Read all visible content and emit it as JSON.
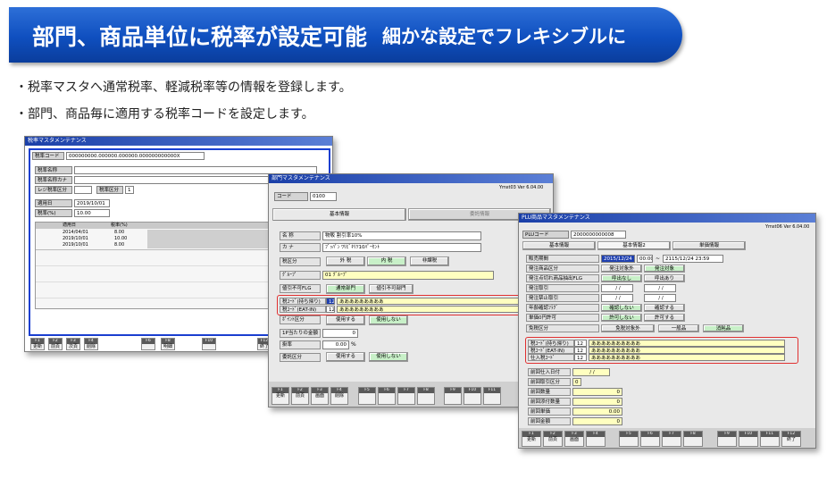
{
  "banner": {
    "title": "部門、商品単位に税率が設定可能",
    "subtitle": "細かな設定でフレキシブルに"
  },
  "bullets": [
    "・税率マスタへ通常税率、軽減税率等の情報を登録します。",
    "・部門、商品毎に適用する税率コードを設定します。"
  ],
  "window1": {
    "title": "税率マスタメンテナンス",
    "code_label": "税率コード",
    "code_value": "000000000.000000.000000.000000000000X",
    "name_label": "税率名称",
    "kana_label": "税率名称カナ",
    "rank_label": "レジ税率区分",
    "area_label": "税率区分",
    "area_value": "1",
    "start_label": "適用日",
    "start_value": "2019/10/01",
    "rate_label": "税率(%)",
    "rate_value": "10.00",
    "grid_headers": [
      "適用日",
      "税率(%)"
    ],
    "grid_rows": [
      [
        "2014/04/01",
        "8.00"
      ],
      [
        "2019/10/01",
        "10.00"
      ],
      [
        "2019/10/01",
        "8.00"
      ]
    ],
    "fkeys": [
      "F1",
      "F2",
      "F3",
      "F4",
      "F6",
      "F8",
      "F10",
      "F12"
    ],
    "fkey_labels": [
      "更新",
      "前頁",
      "次頁",
      "削除",
      "",
      "明細",
      "",
      "終了"
    ]
  },
  "window2": {
    "title": "部門マスタメンテナンス",
    "version": "Ymst03  Ver 6.04.00",
    "code_label": "コード",
    "code_value": "0100",
    "tab_basic": "基本情報",
    "tab_delegate": "委託情報",
    "name_label": "名 称",
    "name_value": "物販 割引率10%",
    "kana_label": "カ ナ",
    "kana_value": "ﾌﾞｯﾊﾟﾝ ﾜﾘﾋﾞｷﾘﾂ10ﾊﾟｰｾﾝﾄ",
    "taxkind_label": "税区分",
    "taxkind_opts": [
      "外 税",
      "内 税",
      "非課税"
    ],
    "group_label": "ｸﾞﾙｰﾌﾟ",
    "group_value": "01 ｸﾞﾙｰﾌﾟ",
    "discount_label": "値引不可FLG",
    "discount_opts": [
      "通常部門",
      "値引不可部門"
    ],
    "taxcode_take_label": "税ｺｰﾄﾞ(持ち帰り)",
    "taxcode_take_value": "12",
    "taxcode_take_name": "あああああああああ",
    "taxcode_eat_label": "税ｺｰﾄﾞ(EAT-IN)",
    "taxcode_eat_value": "12",
    "taxcode_eat_name": "あああああああああ",
    "point_label": "ﾎﾟｲﾝﾄ区分",
    "point_opts": [
      "使用する",
      "使用しない"
    ],
    "pointrate_label": "1P当たりの金額",
    "pointrate_value": "0",
    "rate_label": "掛率",
    "rate_value": "0.00",
    "rate_unit": "%",
    "delegate_label": "委託区分",
    "delegate_opts": [
      "使用する",
      "使用しない"
    ],
    "fkeys": [
      "F1",
      "F2",
      "F3",
      "F4",
      "F5",
      "F6",
      "F7",
      "F8",
      "F9",
      "F10",
      "F11"
    ],
    "fkey_labels": [
      "更新",
      "前頁",
      "画面",
      "削除",
      "",
      "",
      "",
      "",
      "",
      "",
      ""
    ]
  },
  "window3": {
    "title": "PLU商品マスタメンテナンス",
    "version": "Ymst06  Ver 6.04.00",
    "plu_label": "PLUコード",
    "plu_value": "2000000000008",
    "tabs": [
      "基本情報",
      "基本情報2",
      "単価情報"
    ],
    "sale_period_label": "販売期間",
    "sale_from": "2015/12/24",
    "sale_from_time": "00:00",
    "sale_tilde": "~",
    "sale_to": "2115/12/24 23:59",
    "order_kind_label": "発注商品区分",
    "order_kind_opts": [
      "発注対象外",
      "発注対象"
    ],
    "order_flag_label": "発注点切れ商品抽出FLG",
    "order_flag_opts": [
      "呼出なし",
      "呼出あり"
    ],
    "order_take_label": "発注取引",
    "order_stop_label": "発注禁止取引",
    "date_placeholder": "/ /",
    "age_label": "年齢確認ﾌﾗｸﾞ",
    "age_opts": [
      "確認しない",
      "確認する"
    ],
    "zero_label": "単価0円許可",
    "zero_opts": [
      "許可しない",
      "許可する"
    ],
    "taxfree_label": "免税区分",
    "taxfree_opts": [
      "免税対象外",
      "一般品",
      "消耗品"
    ],
    "taxcode_take_label": "税ｺｰﾄﾞ(持ち帰り)",
    "taxcode_take_value": "12",
    "taxcode_take_name": "ああああああああああ",
    "taxcode_eat_label": "税ｺｰﾄﾞ(EAT-IN)",
    "taxcode_eat_value": "12",
    "taxcode_eat_name": "ああああああああああ",
    "buytax_label": "仕入税ｺｰﾄﾞ",
    "buytax_value": "12",
    "buytax_name": "ああああああああああ",
    "last_buy_date_label": "前回仕入日付",
    "last_buy_date_value": "/ /",
    "last_buy_kind_label": "前回取引区分",
    "last_buy_kind_value": "0",
    "last_qty_label": "前回数量",
    "last_qty_value": "0",
    "last_case_label": "前回添付数量",
    "last_case_value": "0",
    "last_unit_label": "前回単価",
    "last_unit_value": "0.00",
    "last_amount_label": "前回金額",
    "last_amount_value": "0",
    "fkeys": [
      "F1",
      "F2",
      "F3",
      "F4",
      "F5",
      "F6",
      "F7",
      "F8",
      "F9",
      "F10",
      "F11",
      "F12"
    ],
    "fkey_labels": [
      "更新",
      "前頁",
      "画面",
      "",
      "",
      "",
      "",
      "",
      "",
      "",
      "",
      "終了"
    ]
  }
}
